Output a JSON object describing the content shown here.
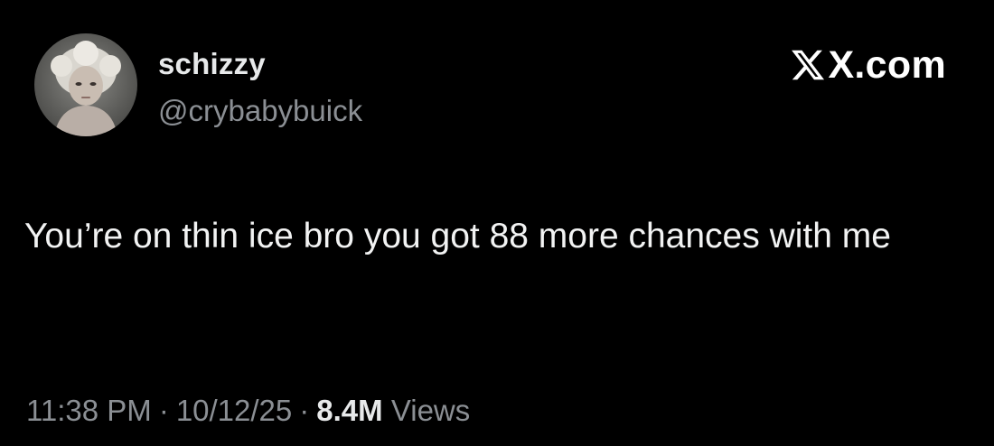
{
  "tweet": {
    "display_name": "schizzy",
    "handle": "@crybabybuick",
    "brand": "X.com",
    "text": "You’re on thin ice bro you got 88 more chances with me",
    "time": "11:38 PM",
    "date": "10/12/25",
    "separator": "·",
    "views_count": "8.4M",
    "views_label": "Views"
  },
  "colors": {
    "background": "#000000",
    "primary_text": "#e7e9ea",
    "secondary_text": "#8b8f94"
  },
  "icons": {
    "brand": "x-logo-icon",
    "avatar": "profile-photo"
  }
}
